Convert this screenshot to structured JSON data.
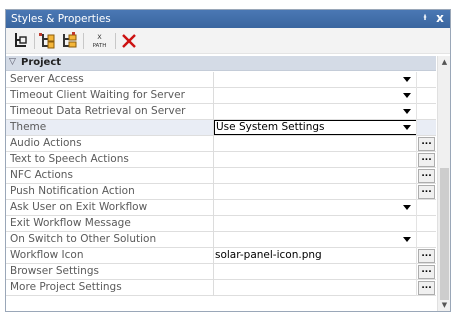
{
  "window": {
    "title": "Styles & Properties",
    "pin_glyph": "ᵼ",
    "close_glyph": "x"
  },
  "toolbar": {
    "buttons": [
      {
        "name": "tree-view-icon"
      },
      {
        "name": "add-child-icon"
      },
      {
        "name": "add-sibling-icon"
      },
      {
        "name": "xpath-icon",
        "label_top": "X",
        "label_bottom": "PATH"
      },
      {
        "name": "delete-icon",
        "color": "#cc1111"
      }
    ]
  },
  "grid": {
    "category": {
      "label": "Project",
      "expanded_glyph": "▽"
    },
    "rows": [
      {
        "name": "Server Access",
        "value": "",
        "control": "dropdown"
      },
      {
        "name": "Timeout Client Waiting for Server",
        "value": "",
        "control": "dropdown"
      },
      {
        "name": "Timeout Data Retrieval on Server",
        "value": "",
        "control": "dropdown"
      },
      {
        "name": "Theme",
        "value": "Use System Settings",
        "control": "combo-open"
      },
      {
        "name": "Audio Actions",
        "value": "",
        "control": "ellipsis"
      },
      {
        "name": "Text to Speech Actions",
        "value": "",
        "control": "ellipsis"
      },
      {
        "name": "NFC Actions",
        "value": "",
        "control": "ellipsis"
      },
      {
        "name": "Push Notification Action",
        "value": "",
        "control": "ellipsis"
      },
      {
        "name": "Ask User on Exit Workflow",
        "value": "",
        "control": "dropdown"
      },
      {
        "name": "Exit Workflow Message",
        "value": "",
        "control": "none"
      },
      {
        "name": "On Switch to Other Solution",
        "value": "",
        "control": "dropdown"
      },
      {
        "name": "Workflow Icon",
        "value": "solar-panel-icon.png",
        "control": "ellipsis"
      },
      {
        "name": "Browser Settings",
        "value": "",
        "control": "ellipsis"
      },
      {
        "name": "More Project Settings",
        "value": "",
        "control": "ellipsis"
      }
    ],
    "ellipsis_label": "..."
  },
  "scrollbar": {
    "up_glyph": "▲",
    "down_glyph": "▼"
  },
  "colors": {
    "titlebar": "#3f6ea8",
    "category_bg": "#d4dbe6",
    "selected_row": "#e9edf5",
    "delete_red": "#cc1111"
  }
}
